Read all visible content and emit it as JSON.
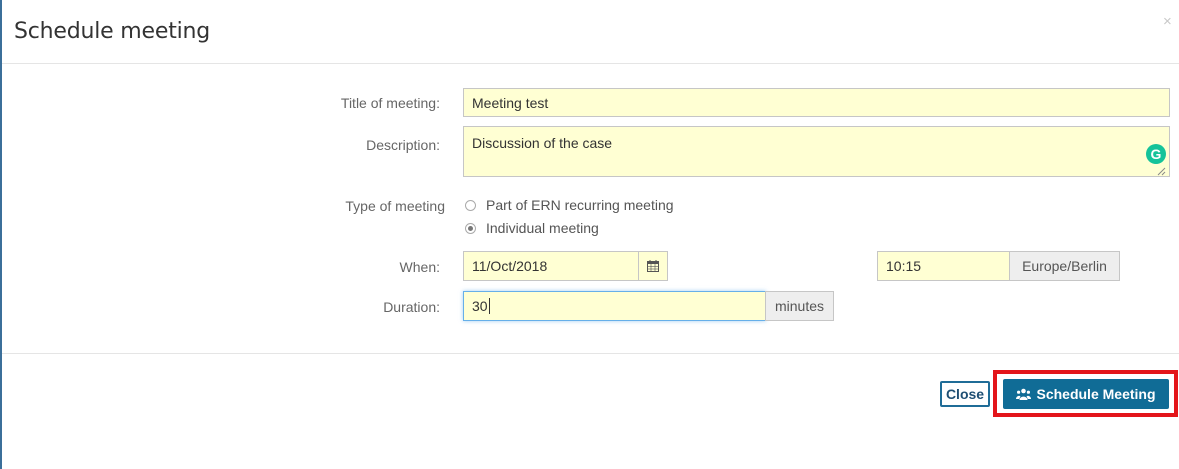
{
  "dialog": {
    "title": "Schedule meeting",
    "close_symbol": "×"
  },
  "form": {
    "title_label": "Title of meeting:",
    "title_value": "Meeting test",
    "description_label": "Description:",
    "description_value": "Discussion of the case",
    "type_label": "Type of meeting",
    "type_options": [
      {
        "label": "Part of ERN recurring meeting",
        "checked": false
      },
      {
        "label": "Individual meeting",
        "checked": true
      }
    ],
    "when_label": "When:",
    "date_value": "11/Oct/2018",
    "time_value": "10:15",
    "timezone": "Europe/Berlin",
    "duration_label": "Duration:",
    "duration_value": "30",
    "duration_unit": "minutes"
  },
  "footer": {
    "close_label": "Close",
    "schedule_label": "Schedule Meeting"
  },
  "icons": {
    "calendar": "calendar-icon",
    "meeting": "users-icon",
    "grammarly": "grammarly-icon",
    "grammarly_glyph": "G"
  },
  "colors": {
    "input_bg": "#ffffd3",
    "primary": "#106c96",
    "highlight": "#e3151a"
  }
}
